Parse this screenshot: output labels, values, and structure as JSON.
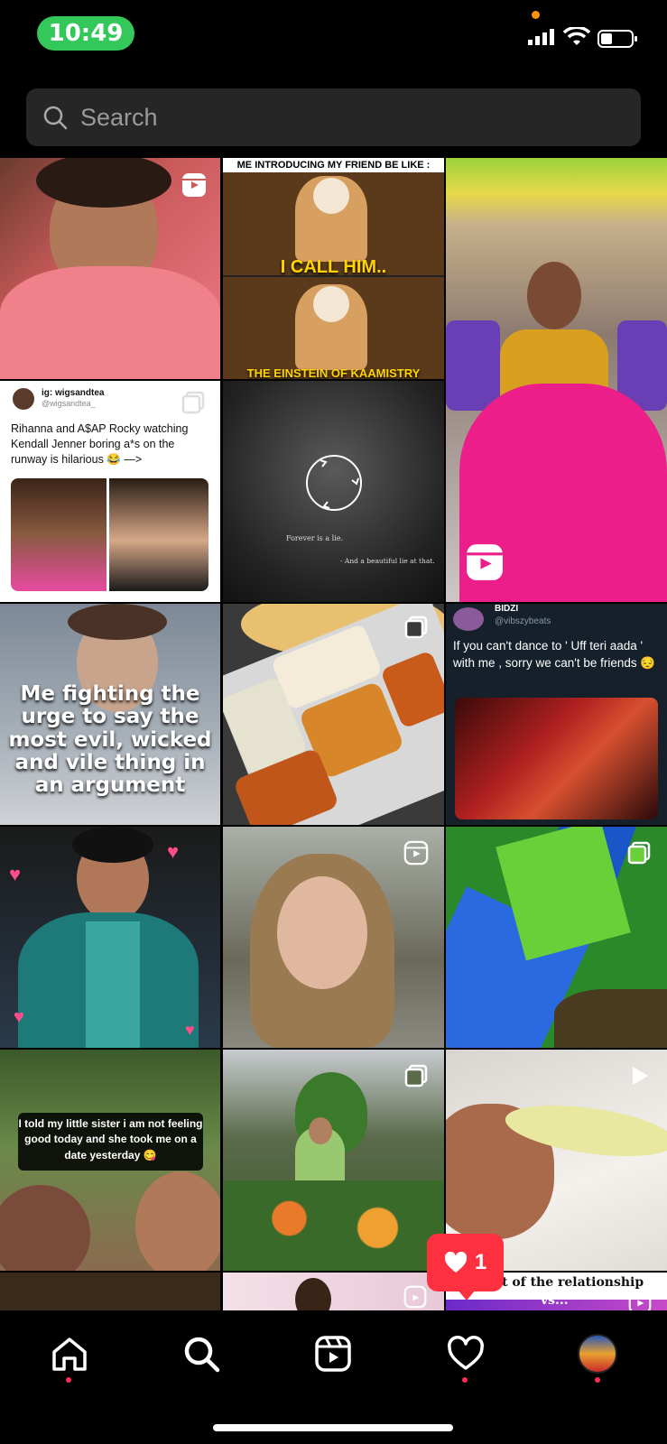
{
  "status_bar": {
    "time": "10:49"
  },
  "search": {
    "placeholder": "Search"
  },
  "tiles": {
    "t2": {
      "top_caption": "ME INTRODUCING MY FRIEND BE LIKE :",
      "mid_caption": "I CALL HIM..",
      "bottom_caption": "THE EINSTEIN OF KAAMISTRY"
    },
    "t4": {
      "handle_name": "ig: wigsandtea",
      "handle_id": "@wigsandtea_",
      "text": "Rihanna and A$AP Rocky watching Kendall Jenner boring a*s on the runway is hilarious 😂 —>"
    },
    "t5": {
      "line1": "Forever is a lie.",
      "line2": "- And a beautiful lie at that."
    },
    "t7": {
      "text": "Me fighting the urge to say the most evil, wicked and vile thing in an argument"
    },
    "t9": {
      "name": "BIDZI",
      "handle": "@vibszybeats",
      "text": "If you can't dance to ' Uff teri aada ' with me , sorry we can't be friends 😔"
    },
    "t13": {
      "text": "I told my little sister i am not feeling good today and she took me on a date yesterday 😋"
    },
    "t17": {
      "text1": "t of the relationship",
      "text2": "vs..."
    }
  },
  "notification": {
    "count": "1"
  },
  "colors": {
    "accent": "#ff3040",
    "status_green": "#34c759",
    "tab_dot": "#ff2d55"
  },
  "icons": [
    "search-icon",
    "reels-icon",
    "carousel-icon",
    "play-icon",
    "home-icon",
    "heart-icon",
    "profile-avatar"
  ]
}
